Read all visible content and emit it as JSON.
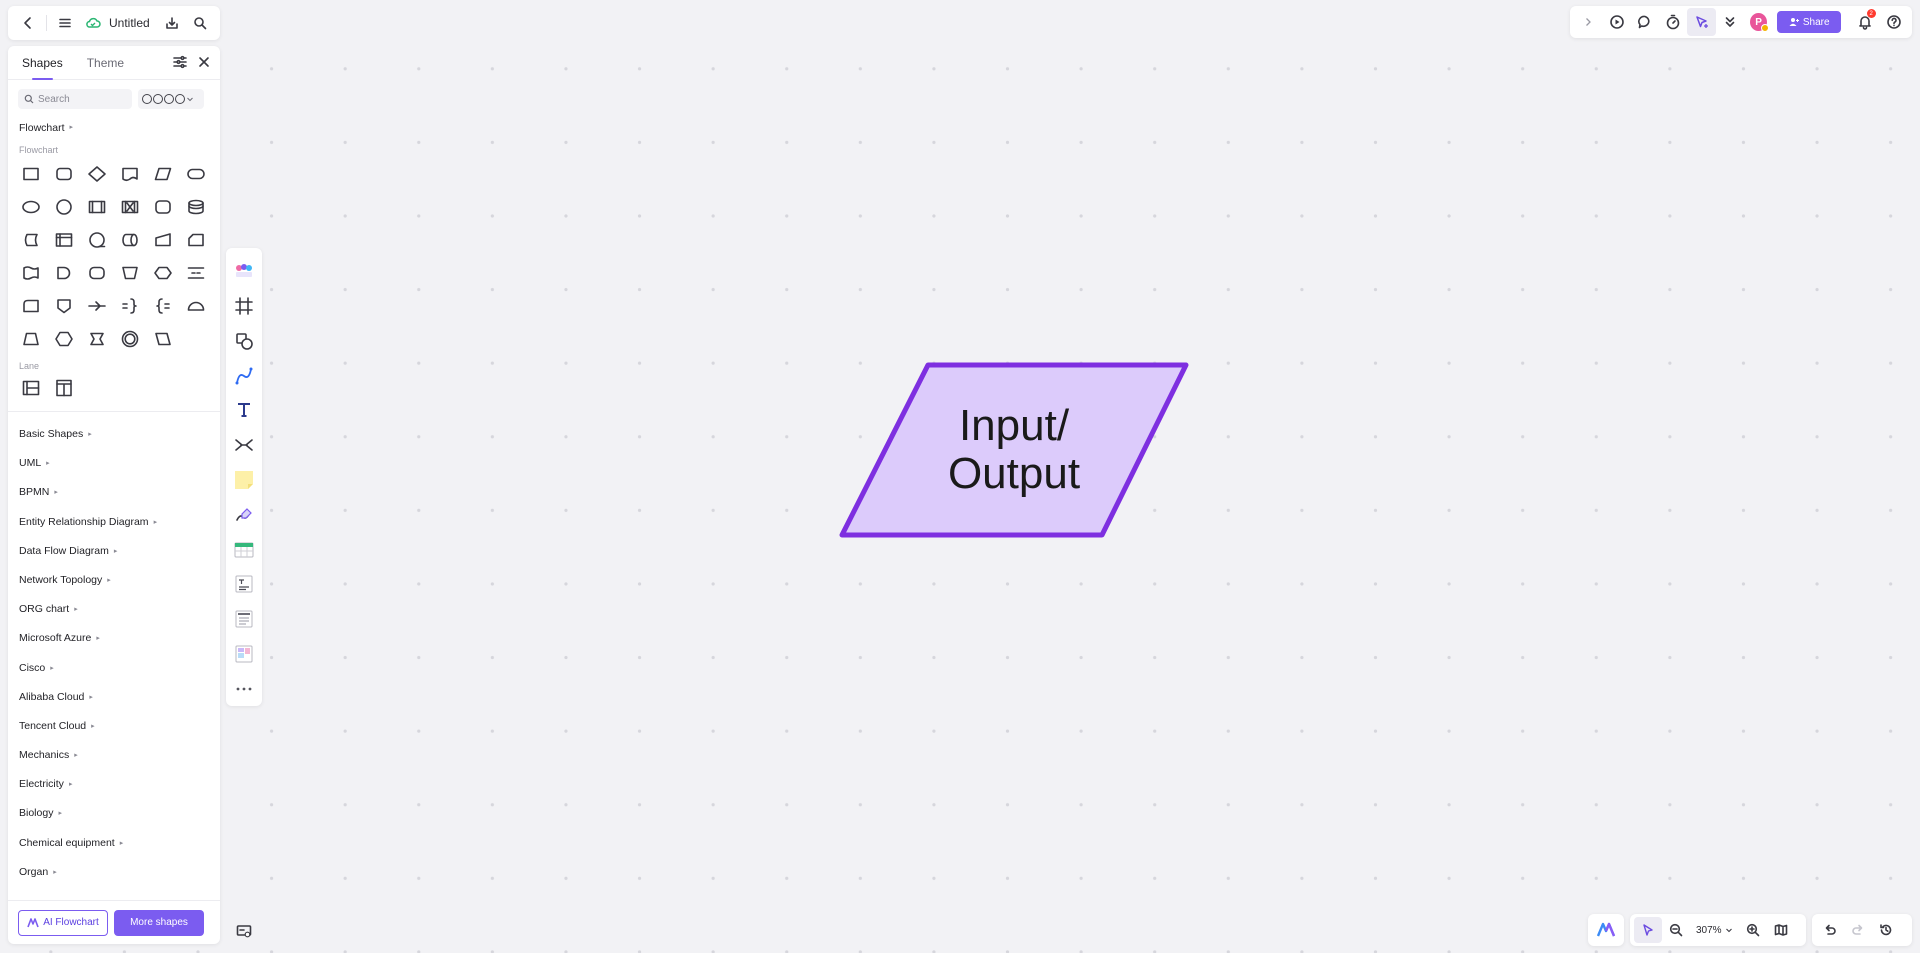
{
  "document": {
    "title": "Untitled"
  },
  "panel": {
    "tabs": [
      {
        "label": "Shapes"
      },
      {
        "label": "Theme"
      }
    ],
    "search": {
      "placeholder": "Search"
    },
    "flowchart": {
      "title": "Flowchart",
      "sub_label": "Flowchart",
      "lane_label": "Lane"
    },
    "categories": [
      "Basic Shapes",
      "UML",
      "BPMN",
      "Entity Relationship Diagram",
      "Data Flow Diagram",
      "Network Topology",
      "ORG chart",
      "Microsoft Azure",
      "Cisco",
      "Alibaba Cloud",
      "Tencent Cloud",
      "Mechanics",
      "Electricity",
      "Biology",
      "Chemical equipment",
      "Organ"
    ],
    "footer": {
      "ai_button": "AI Flowchart",
      "more_button": "More shapes"
    }
  },
  "topbar_right": {
    "avatar_initial": "P",
    "share_label": "Share",
    "notification_count": "2"
  },
  "zoom": {
    "level": "307%"
  },
  "canvas": {
    "shape": {
      "type": "parallelogram",
      "text": "Input/\nOutput",
      "fill": "#dccbfb",
      "stroke": "#7e2fe0"
    }
  },
  "colors": {
    "accent": "#7b5cf0",
    "canvas_bg": "#f2f2f5"
  }
}
